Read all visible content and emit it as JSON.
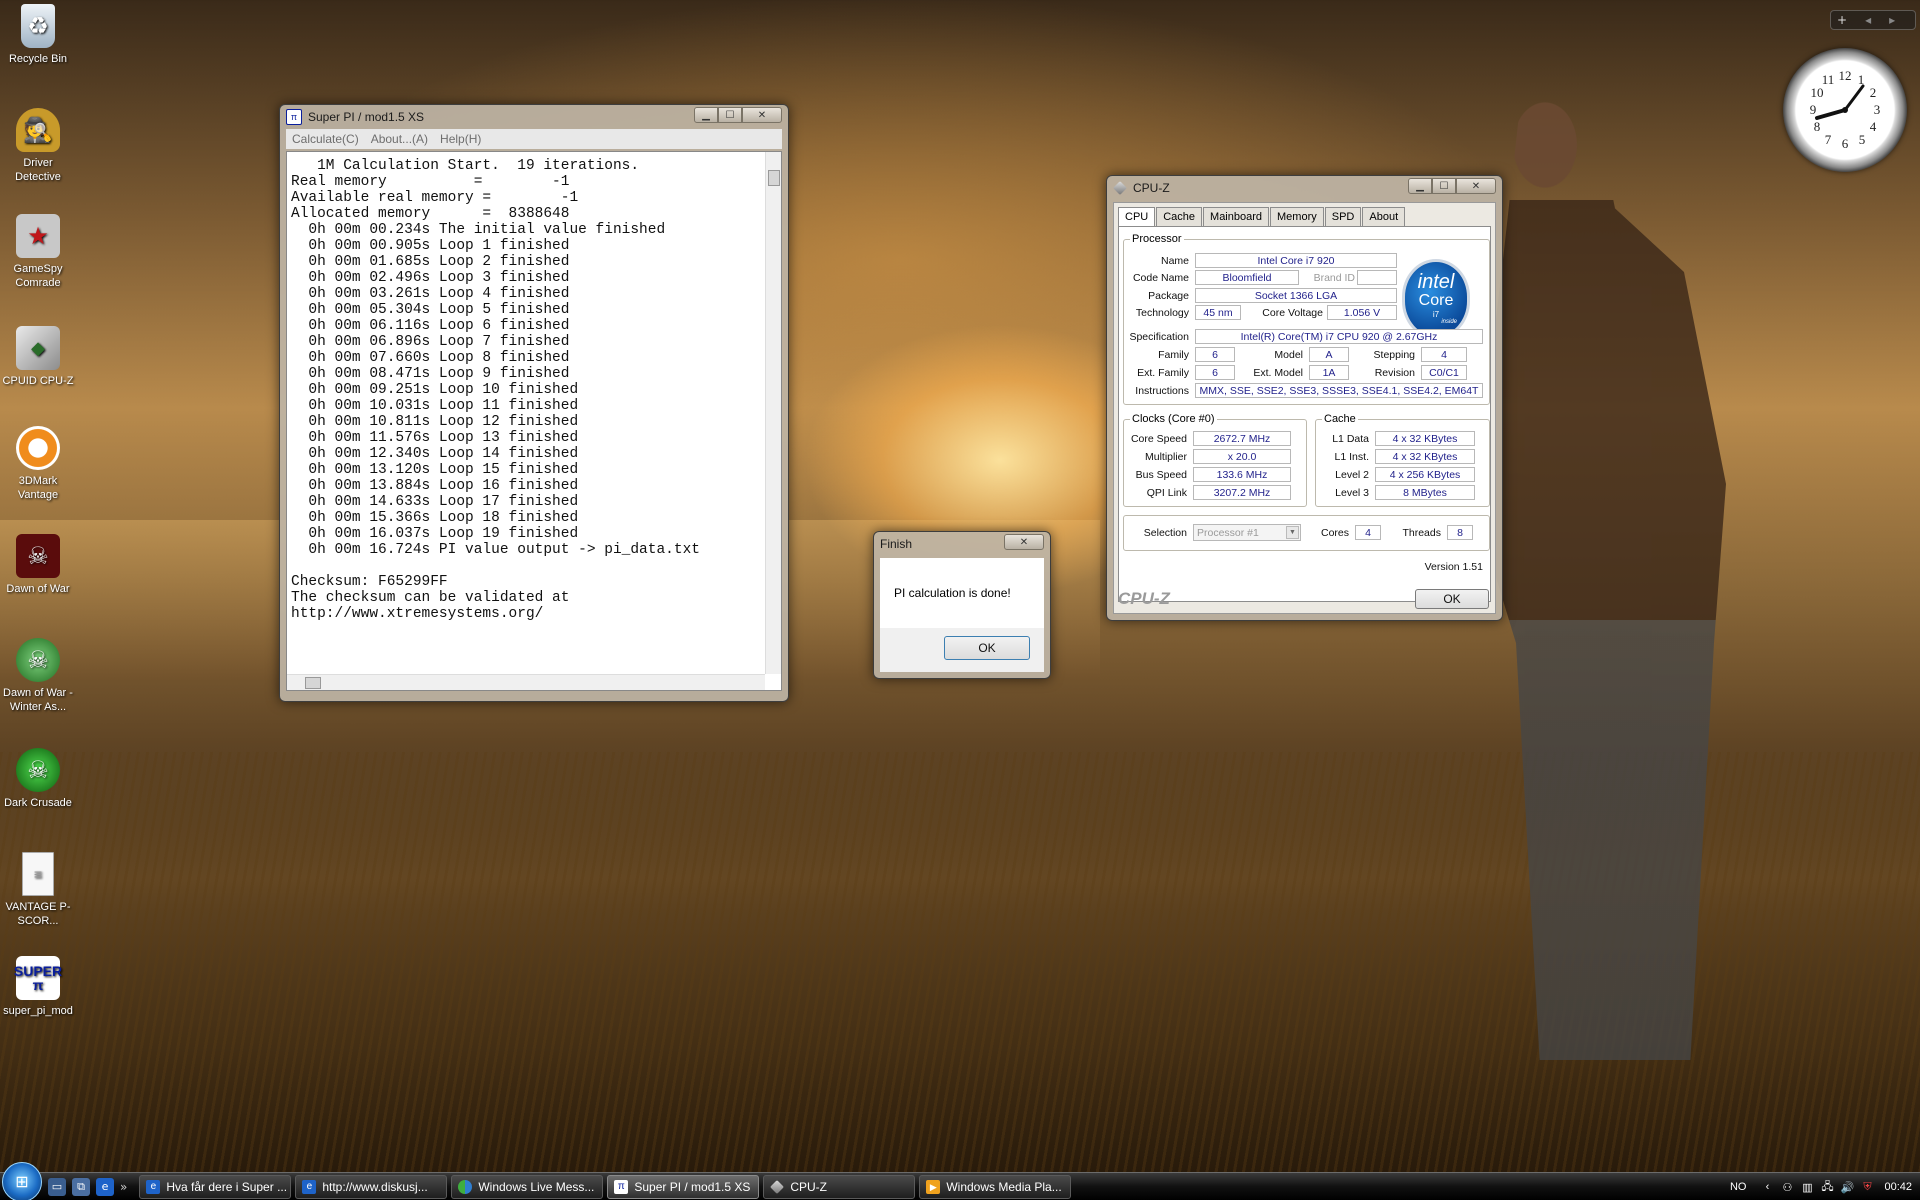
{
  "desktop": {
    "icons": [
      {
        "label": "Recycle Bin",
        "icon": "recycle-bin-icon"
      },
      {
        "label": "Driver Detective",
        "icon": "detective-icon"
      },
      {
        "label": "GameSpy Comrade",
        "icon": "gamespy-star-icon"
      },
      {
        "label": "CPUID CPU-Z",
        "icon": "cpuz-icon"
      },
      {
        "label": "3DMark Vantage",
        "icon": "3dmark-icon"
      },
      {
        "label": "Dawn of War",
        "icon": "skull-icon"
      },
      {
        "label": "Dawn of War - Winter As...",
        "icon": "winter-assault-icon"
      },
      {
        "label": "Dark Crusade",
        "icon": "dark-crusade-icon"
      },
      {
        "label": "VANTAGE P-SCOR...",
        "icon": "document-icon"
      },
      {
        "label": "super_pi_mod",
        "icon": "superpi-icon"
      }
    ]
  },
  "superpi": {
    "title": "Super PI / mod1.5 XS",
    "menu": [
      "Calculate(C)",
      "About...(A)",
      "Help(H)"
    ],
    "lines": [
      "   1M Calculation Start.  19 iterations.",
      "Real memory          =        -1",
      "Available real memory =        -1",
      "Allocated memory      =  8388648",
      "  0h 00m 00.234s The initial value finished",
      "  0h 00m 00.905s Loop 1 finished",
      "  0h 00m 01.685s Loop 2 finished",
      "  0h 00m 02.496s Loop 3 finished",
      "  0h 00m 03.261s Loop 4 finished",
      "  0h 00m 05.304s Loop 5 finished",
      "  0h 00m 06.116s Loop 6 finished",
      "  0h 00m 06.896s Loop 7 finished",
      "  0h 00m 07.660s Loop 8 finished",
      "  0h 00m 08.471s Loop 9 finished",
      "  0h 00m 09.251s Loop 10 finished",
      "  0h 00m 10.031s Loop 11 finished",
      "  0h 00m 10.811s Loop 12 finished",
      "  0h 00m 11.576s Loop 13 finished",
      "  0h 00m 12.340s Loop 14 finished",
      "  0h 00m 13.120s Loop 15 finished",
      "  0h 00m 13.884s Loop 16 finished",
      "  0h 00m 14.633s Loop 17 finished",
      "  0h 00m 15.366s Loop 18 finished",
      "  0h 00m 16.037s Loop 19 finished",
      "  0h 00m 16.724s PI value output -> pi_data.txt",
      "",
      "Checksum: F65299FF",
      "The checksum can be validated at",
      "http://www.xtremesystems.org/"
    ]
  },
  "finish": {
    "title": "Finish",
    "message": "PI calculation is done!",
    "ok": "OK"
  },
  "cpuz": {
    "title": "CPU-Z",
    "tabs": [
      "CPU",
      "Cache",
      "Mainboard",
      "Memory",
      "SPD",
      "About"
    ],
    "processor": {
      "legend": "Processor",
      "name_label": "Name",
      "name": "Intel Core i7 920",
      "codename_label": "Code Name",
      "codename": "Bloomfield",
      "brandid_label": "Brand ID",
      "brandid": "",
      "package_label": "Package",
      "package": "Socket 1366 LGA",
      "technology_label": "Technology",
      "technology": "45 nm",
      "voltage_label": "Core Voltage",
      "voltage": "1.056 V",
      "spec_label": "Specification",
      "spec": "Intel(R) Core(TM) i7 CPU       920  @ 2.67GHz",
      "family_label": "Family",
      "family": "6",
      "model_label": "Model",
      "model": "A",
      "stepping_label": "Stepping",
      "stepping": "4",
      "extfamily_label": "Ext. Family",
      "extfamily": "6",
      "extmodel_label": "Ext. Model",
      "extmodel": "1A",
      "revision_label": "Revision",
      "revision": "C0/C1",
      "instructions_label": "Instructions",
      "instructions": "MMX, SSE, SSE2, SSE3, SSSE3, SSE4.1, SSE4.2, EM64T"
    },
    "logo": {
      "brand": "intel",
      "line": "Core",
      "model": "i7",
      "tag": "inside"
    },
    "clocks": {
      "legend": "Clocks (Core #0)",
      "core_speed_label": "Core Speed",
      "core_speed": "2672.7 MHz",
      "multiplier_label": "Multiplier",
      "multiplier": "x 20.0",
      "bus_speed_label": "Bus Speed",
      "bus_speed": "133.6 MHz",
      "qpi_label": "QPI Link",
      "qpi": "3207.2 MHz"
    },
    "cache": {
      "legend": "Cache",
      "l1d_label": "L1 Data",
      "l1d": "4 x 32 KBytes",
      "l1i_label": "L1 Inst.",
      "l1i": "4 x 32 KBytes",
      "l2_label": "Level 2",
      "l2": "4 x 256 KBytes",
      "l3_label": "Level 3",
      "l3": "8 MBytes"
    },
    "selection_label": "Selection",
    "selection": "Processor #1",
    "cores_label": "Cores",
    "cores": "4",
    "threads_label": "Threads",
    "threads": "8",
    "version": "Version 1.51",
    "brand": "CPU-Z",
    "ok": "OK"
  },
  "taskbar": {
    "buttons": [
      {
        "label": "Hva får dere i Super ...",
        "icon": "ie-icon"
      },
      {
        "label": "http://www.diskusj...",
        "icon": "ie-icon"
      },
      {
        "label": "Windows Live Mess...",
        "icon": "messenger-icon"
      },
      {
        "label": "Super PI / mod1.5 XS",
        "icon": "superpi-icon"
      },
      {
        "label": "CPU-Z",
        "icon": "cpuz-icon"
      },
      {
        "label": "Windows Media Pla...",
        "icon": "media-player-icon"
      }
    ],
    "lang": "NO",
    "time": "00:42"
  },
  "colors": {
    "accent": "#1f1f8a",
    "taskbar": "#111111",
    "orb": "#1b6bc4"
  }
}
